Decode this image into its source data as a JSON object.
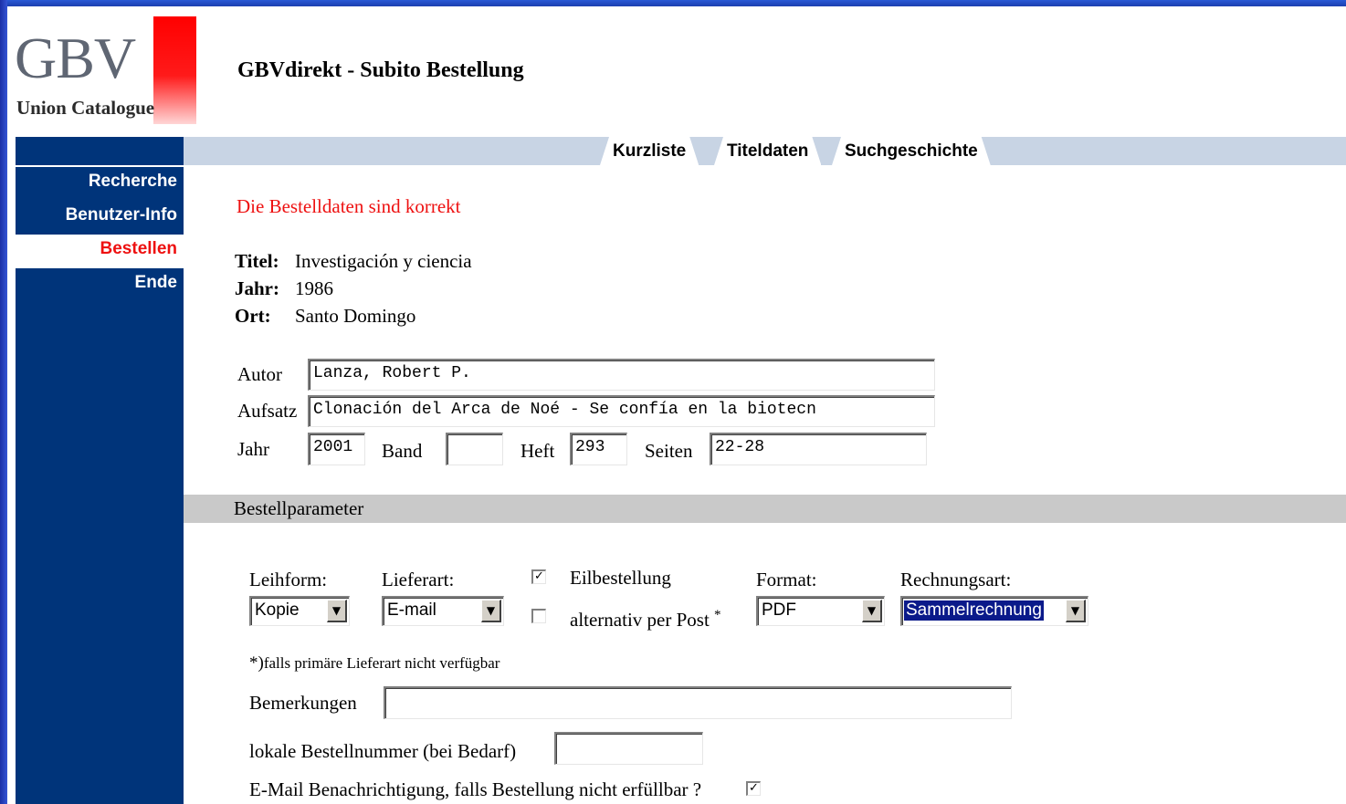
{
  "logo": {
    "main": "GBV",
    "sub": "Union Catalogue",
    "accent_color": "#ff0000"
  },
  "header": {
    "title": "GBVdirekt - Subito Bestellung"
  },
  "tabs": [
    {
      "label": "Kurzliste"
    },
    {
      "label": "Titeldaten"
    },
    {
      "label": "Suchgeschichte"
    }
  ],
  "sidebar": {
    "items": [
      {
        "label": "Recherche",
        "active": false
      },
      {
        "label": "Benutzer-Info",
        "active": false
      },
      {
        "label": "Bestellen",
        "active": true
      },
      {
        "label": "Ende",
        "active": false
      }
    ]
  },
  "notice": "Die Bestelldaten sind korrekt",
  "title_info": {
    "titel_label": "Titel:",
    "titel_value": "Investigación y ciencia",
    "jahr_label": "Jahr:",
    "jahr_value": "1986",
    "ort_label": "Ort:",
    "ort_value": "Santo Domingo"
  },
  "article": {
    "autor_label": "Autor",
    "autor_value": "Lanza, Robert P.",
    "aufsatz_label": "Aufsatz",
    "aufsatz_value": "Clonación del Arca de Noé - Se confía en la biotecn",
    "jahr_label": "Jahr",
    "jahr_value": "2001",
    "band_label": "Band",
    "band_value": "",
    "heft_label": "Heft",
    "heft_value": "293",
    "seiten_label": "Seiten",
    "seiten_value": "22-28"
  },
  "section": {
    "title": "Bestellparameter"
  },
  "order": {
    "leihform_label": "Leihform:",
    "leihform_value": "Kopie",
    "lieferart_label": "Lieferart:",
    "lieferart_value": "E-mail",
    "eilbestellung_label": "Eilbestellung",
    "eilbestellung_checked": true,
    "alt_post_label": "alternativ per Post",
    "alt_post_marker": "*",
    "alt_post_checked": false,
    "format_label": "Format:",
    "format_value": "PDF",
    "rechnungsart_label": "Rechnungsart:",
    "rechnungsart_value": "Sammelrechnung",
    "footnote_marker": "*)",
    "footnote_text": "falls primäre Lieferart nicht verfügbar",
    "bemerkungen_label": "Bemerkungen",
    "bemerkungen_value": "",
    "bestellnummer_label": "lokale Bestellnummer (bei Bedarf)",
    "bestellnummer_value": "",
    "email_notify_label": "E-Mail Benachrichtigung, falls Bestellung nicht erfüllbar ?",
    "email_notify_checked": true
  },
  "colors": {
    "nav_bg": "#00347a",
    "tabbar_bg": "#c8d4e4",
    "alert": "#ee1111",
    "section_bg": "#c9c9c9"
  }
}
